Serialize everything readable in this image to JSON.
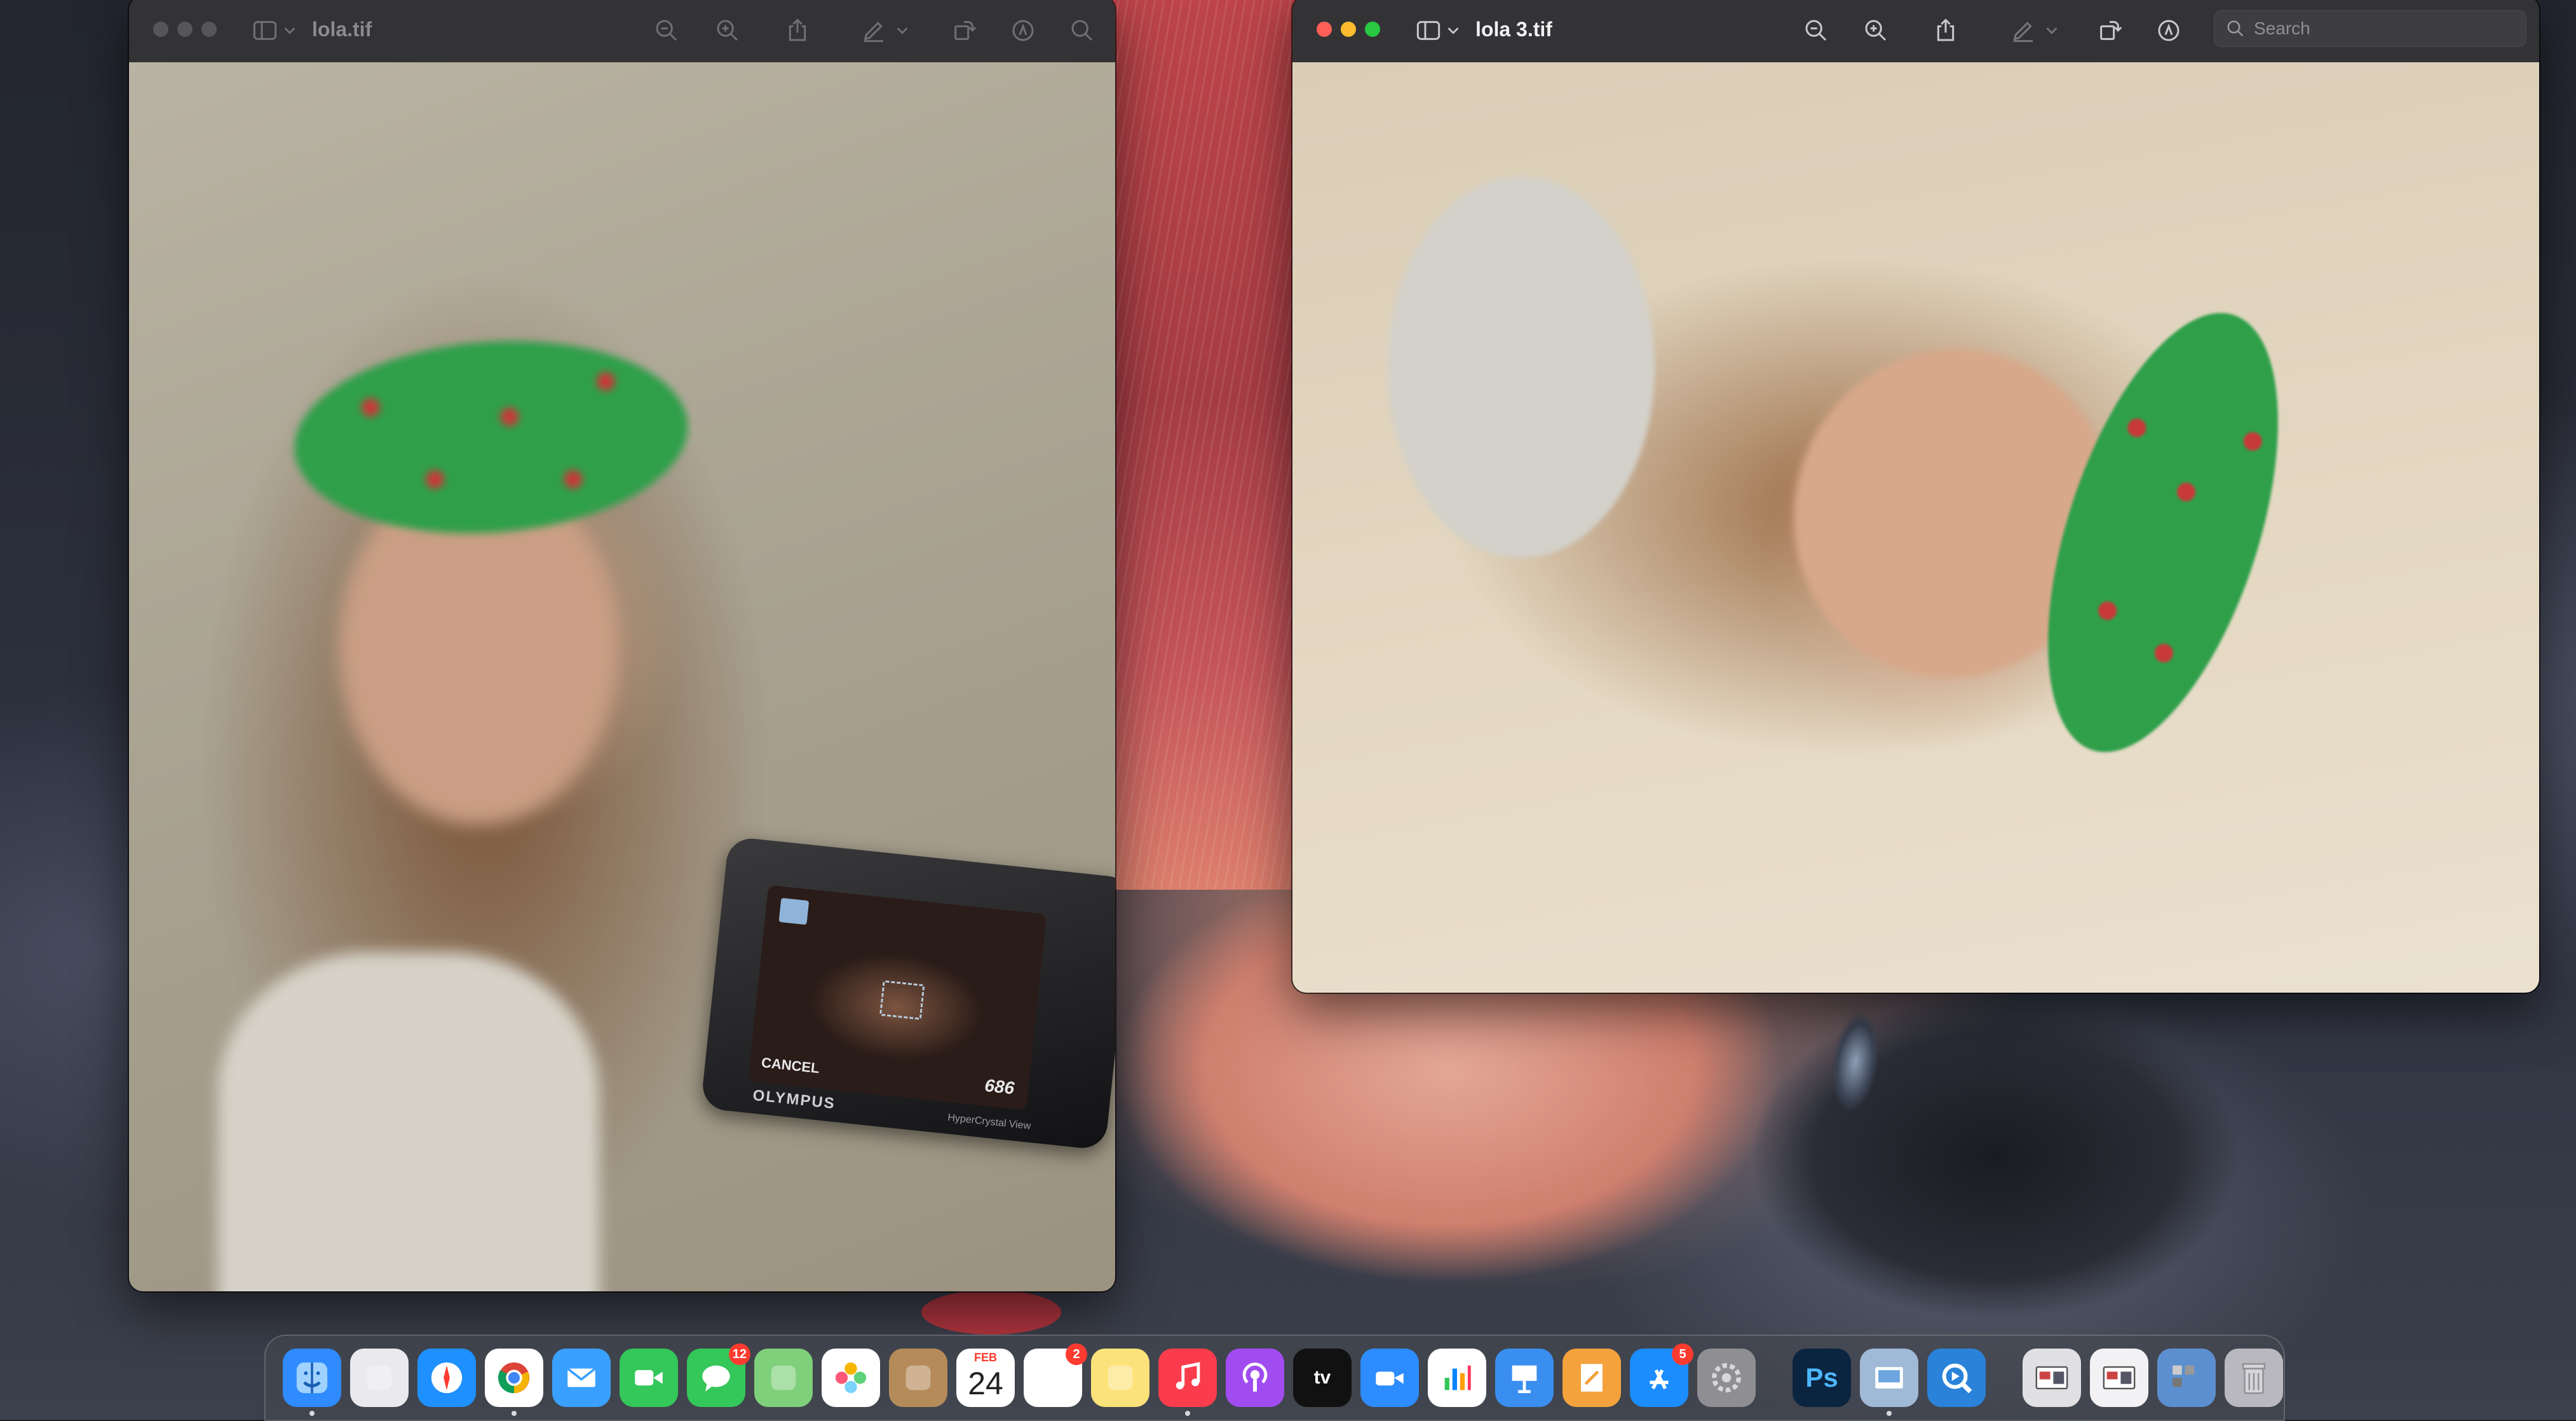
{
  "windows": {
    "left": {
      "title": "lola.tif",
      "camera": {
        "screen_label": "CANCEL",
        "shot_count": "686",
        "brand": "OLYMPUS",
        "subtitle": "HyperCrystal View"
      }
    },
    "right": {
      "title": "lola 3.tif",
      "search_placeholder": "Search"
    }
  },
  "dock": {
    "items": [
      {
        "name": "Finder",
        "icon": "finder-icon",
        "color": "#2f8bff",
        "running": true
      },
      {
        "name": "Launchpad",
        "icon": "launchpad-icon",
        "color": "#e9e9ee"
      },
      {
        "name": "Safari",
        "icon": "safari-icon",
        "color": "#1e90ff"
      },
      {
        "name": "Google Chrome",
        "icon": "chrome-icon",
        "color": "#ffffff",
        "running": true
      },
      {
        "name": "Mail",
        "icon": "mail-icon",
        "color": "#3aa0ff"
      },
      {
        "name": "FaceTime",
        "icon": "facetime-icon",
        "color": "#34c759"
      },
      {
        "name": "Messages",
        "icon": "messages-icon",
        "color": "#34c759",
        "badge": "12"
      },
      {
        "name": "Maps",
        "icon": "maps-icon",
        "color": "#7ed07a"
      },
      {
        "name": "Photos",
        "icon": "photos-icon",
        "color": "#ffffff"
      },
      {
        "name": "Contacts",
        "icon": "contacts-icon",
        "color": "#b58b5a"
      },
      {
        "name": "Calendar",
        "icon": "calendar-icon",
        "color": "#ffffff",
        "month": "FEB",
        "day": "24"
      },
      {
        "name": "Reminders",
        "icon": "reminders-icon",
        "color": "#ffffff",
        "badge": "2"
      },
      {
        "name": "Notes",
        "icon": "notes-icon",
        "color": "#fbe27a"
      },
      {
        "name": "Music",
        "icon": "music-icon",
        "color": "#fa3c4c",
        "running": true
      },
      {
        "name": "Podcasts",
        "icon": "podcasts-icon",
        "color": "#a14cf0"
      },
      {
        "name": "TV",
        "icon": "tv-icon",
        "color": "#111111",
        "label": "tv"
      },
      {
        "name": "Zoom",
        "icon": "zoom-icon",
        "color": "#2d8cff"
      },
      {
        "name": "Numbers",
        "icon": "numbers-icon",
        "color": "#ffffff"
      },
      {
        "name": "Keynote",
        "icon": "keynote-icon",
        "color": "#3a8ef0"
      },
      {
        "name": "Pages",
        "icon": "pages-icon",
        "color": "#f4a23c"
      },
      {
        "name": "App Store",
        "icon": "appstore-icon",
        "color": "#1c8dff",
        "badge": "5"
      },
      {
        "name": "System Settings",
        "icon": "settings-icon",
        "color": "#8e8e93"
      }
    ],
    "apps": [
      {
        "name": "Photoshop",
        "icon": "photoshop-icon",
        "color": "#0b2440",
        "label": "Ps"
      },
      {
        "name": "Preview",
        "icon": "preview-icon",
        "color": "#9fb9d6",
        "running": true
      },
      {
        "name": "QuickTime Player",
        "icon": "quicktime-icon",
        "color": "#2a82d9"
      }
    ],
    "recent": [
      {
        "name": "Minimized window 1",
        "icon": "window-thumbnail-icon",
        "color": "#e0e0e4"
      },
      {
        "name": "Minimized window 2",
        "icon": "window-thumbnail-icon",
        "color": "#f2f2f4"
      },
      {
        "name": "Applications folder",
        "icon": "folder-stack-icon",
        "color": "#5c8fd0"
      },
      {
        "name": "Trash",
        "icon": "trash-icon",
        "color": "#b8b8be"
      }
    ]
  }
}
